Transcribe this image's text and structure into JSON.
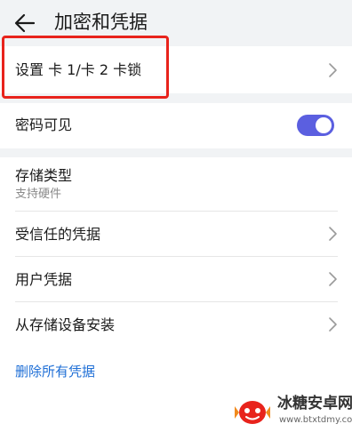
{
  "header": {
    "title": "加密和凭据"
  },
  "items": {
    "sim_lock": {
      "label": "设置 卡 1/卡 2 卡锁"
    },
    "password_visible": {
      "label": "密码可见",
      "enabled": true
    },
    "storage_type": {
      "label": "存储类型",
      "value": "支持硬件"
    },
    "trusted_credentials": {
      "label": "受信任的凭据"
    },
    "user_credentials": {
      "label": "用户凭据"
    },
    "install_from_storage": {
      "label": "从存储设备安装"
    },
    "clear_credentials": {
      "label": "删除所有凭据"
    }
  },
  "watermark": {
    "title": "冰糖安卓网",
    "url": "www.btxtdmy.com"
  },
  "colors": {
    "accent": "#5b5fe0",
    "link": "#1f6fd6",
    "highlight": "#e8231c",
    "background": "#f1f3f5"
  }
}
